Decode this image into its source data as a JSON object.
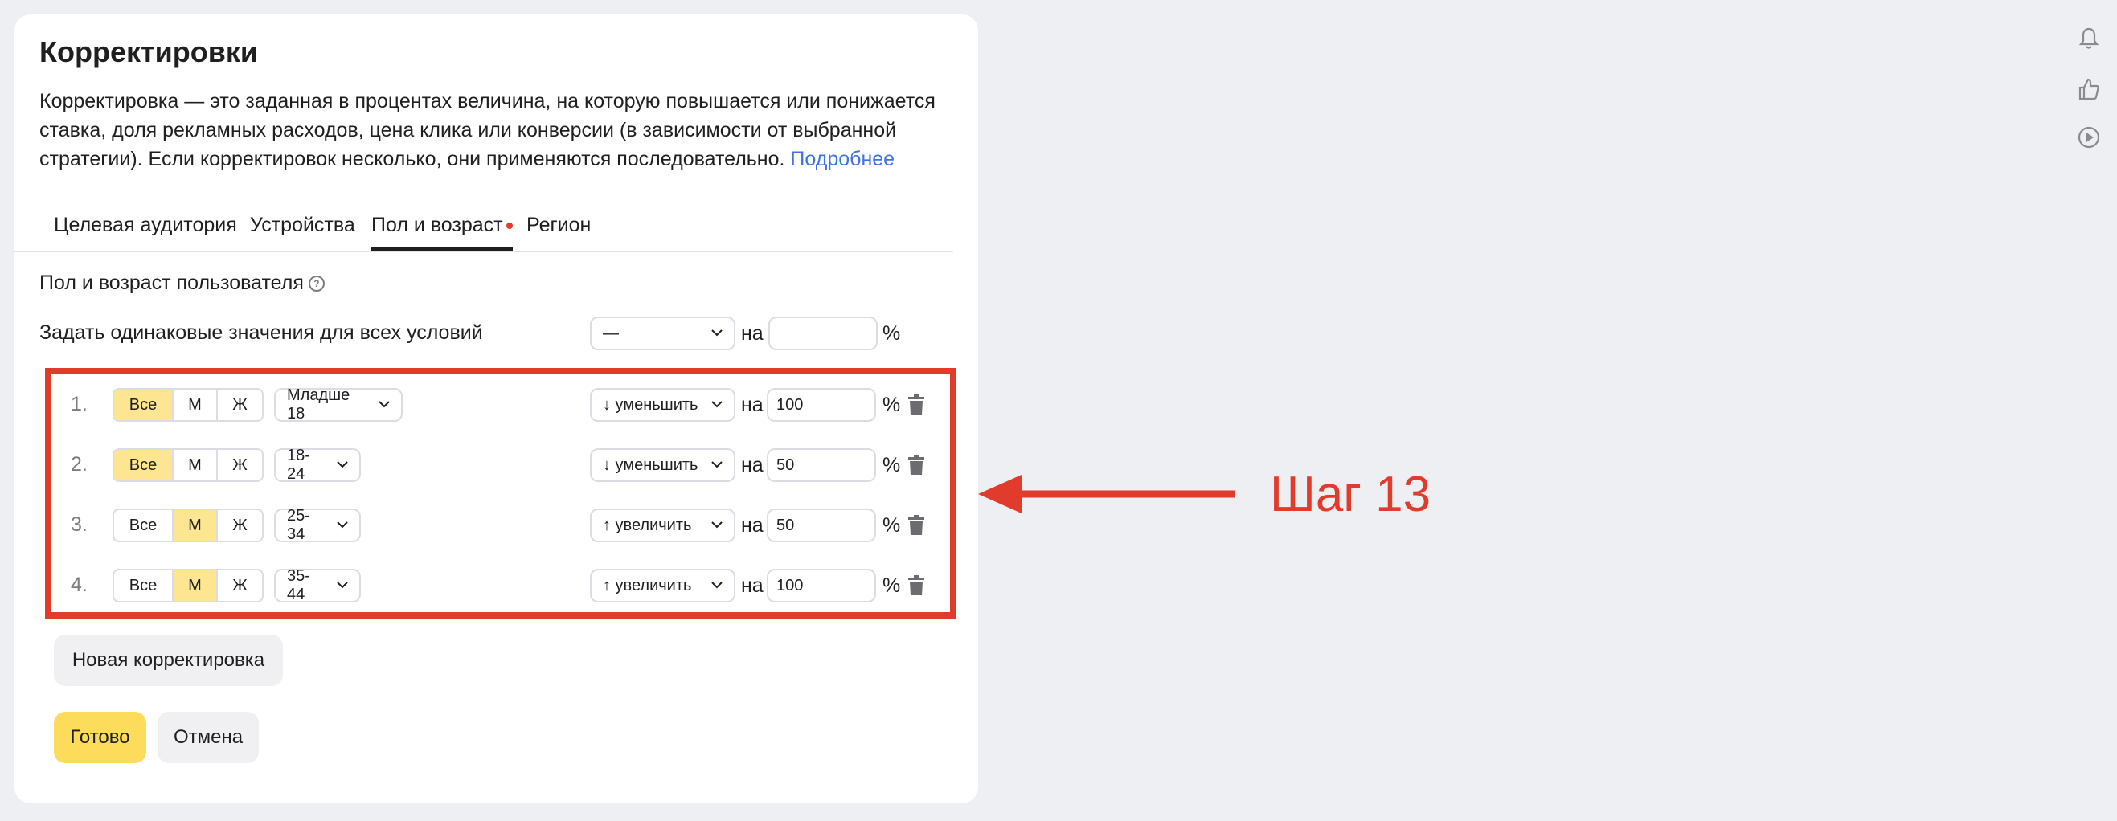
{
  "panel": {
    "title": "Корректировки",
    "description": "Корректировка — это заданная в процентах величина, на которую повышается или понижается ставка, доля рекламных расходов, цена клика или конверсии (в зависимости от выбранной стратегии). Если корректировок несколько, они применяются последовательно.",
    "more_link": "Подробнее"
  },
  "tabs": [
    {
      "label": "Целевая аудитория",
      "active": false
    },
    {
      "label": "Устройства",
      "active": false
    },
    {
      "label": "Пол и возраст",
      "active": true
    },
    {
      "label": "Регион",
      "active": false
    }
  ],
  "section_title": "Пол и возраст пользователя",
  "same_values": {
    "label": "Задать одинаковые значения для всех условий",
    "select_value": "—",
    "na": "на",
    "input_value": "",
    "percent": "%"
  },
  "rows": [
    {
      "num": "1.",
      "gender": [
        "Все",
        "М",
        "Ж"
      ],
      "gender_selected": "Все",
      "age": "Младше 18",
      "direction": "↓ уменьшить",
      "na": "на",
      "value": "100",
      "percent": "%"
    },
    {
      "num": "2.",
      "gender": [
        "Все",
        "М",
        "Ж"
      ],
      "gender_selected": "Все",
      "age": "18-24",
      "direction": "↓ уменьшить",
      "na": "на",
      "value": "50",
      "percent": "%"
    },
    {
      "num": "3.",
      "gender": [
        "Все",
        "М",
        "Ж"
      ],
      "gender_selected": "М",
      "age": "25-34",
      "direction": "↑ увеличить",
      "na": "на",
      "value": "50",
      "percent": "%"
    },
    {
      "num": "4.",
      "gender": [
        "Все",
        "М",
        "Ж"
      ],
      "gender_selected": "М",
      "age": "35-44",
      "direction": "↑ увеличить",
      "na": "на",
      "value": "100",
      "percent": "%"
    }
  ],
  "buttons": {
    "new_adjustment": "Новая корректировка",
    "done": "Готово",
    "cancel": "Отмена"
  },
  "annotation": {
    "text": "Шаг 13",
    "color": "#e13b2c"
  },
  "side_icons": [
    "bell-icon",
    "thumbs-up-icon",
    "play-circle-icon"
  ]
}
